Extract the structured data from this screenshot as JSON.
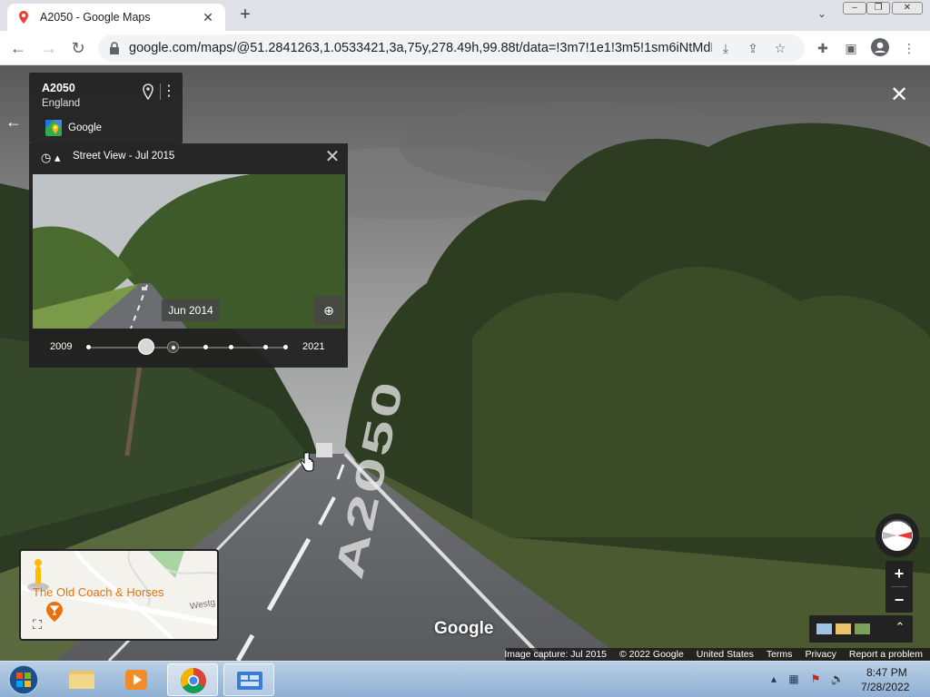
{
  "browser": {
    "tab_title": "A2050 - Google Maps",
    "url": "google.com/maps/@51.2841263,1.0533421,3a,75y,278.49h,99.88t/data=!3m7!1e1!3m5!1sm6iNtMdD8..."
  },
  "place_card": {
    "road": "A2050",
    "region": "England",
    "provider": "Google"
  },
  "timeline": {
    "header": "Street View - Jul 2015",
    "preview_date": "Jun 2014",
    "start_year": "2009",
    "end_year": "2021"
  },
  "minimap": {
    "place_name": "The Old Coach & Horses",
    "street_fragment": "Westg"
  },
  "watermark": "Google",
  "road_marking": "A2050",
  "footer": {
    "image_capture": "Image capture: Jul 2015",
    "copyright": "© 2022 Google",
    "country": "United States",
    "terms": "Terms",
    "privacy": "Privacy",
    "report": "Report a problem"
  },
  "taskbar": {
    "time": "8:47 PM",
    "date": "7/28/2022"
  },
  "colors": {
    "panel_bg": "#222222",
    "place_orange": "#e8710a",
    "compass_red": "#e53935"
  }
}
